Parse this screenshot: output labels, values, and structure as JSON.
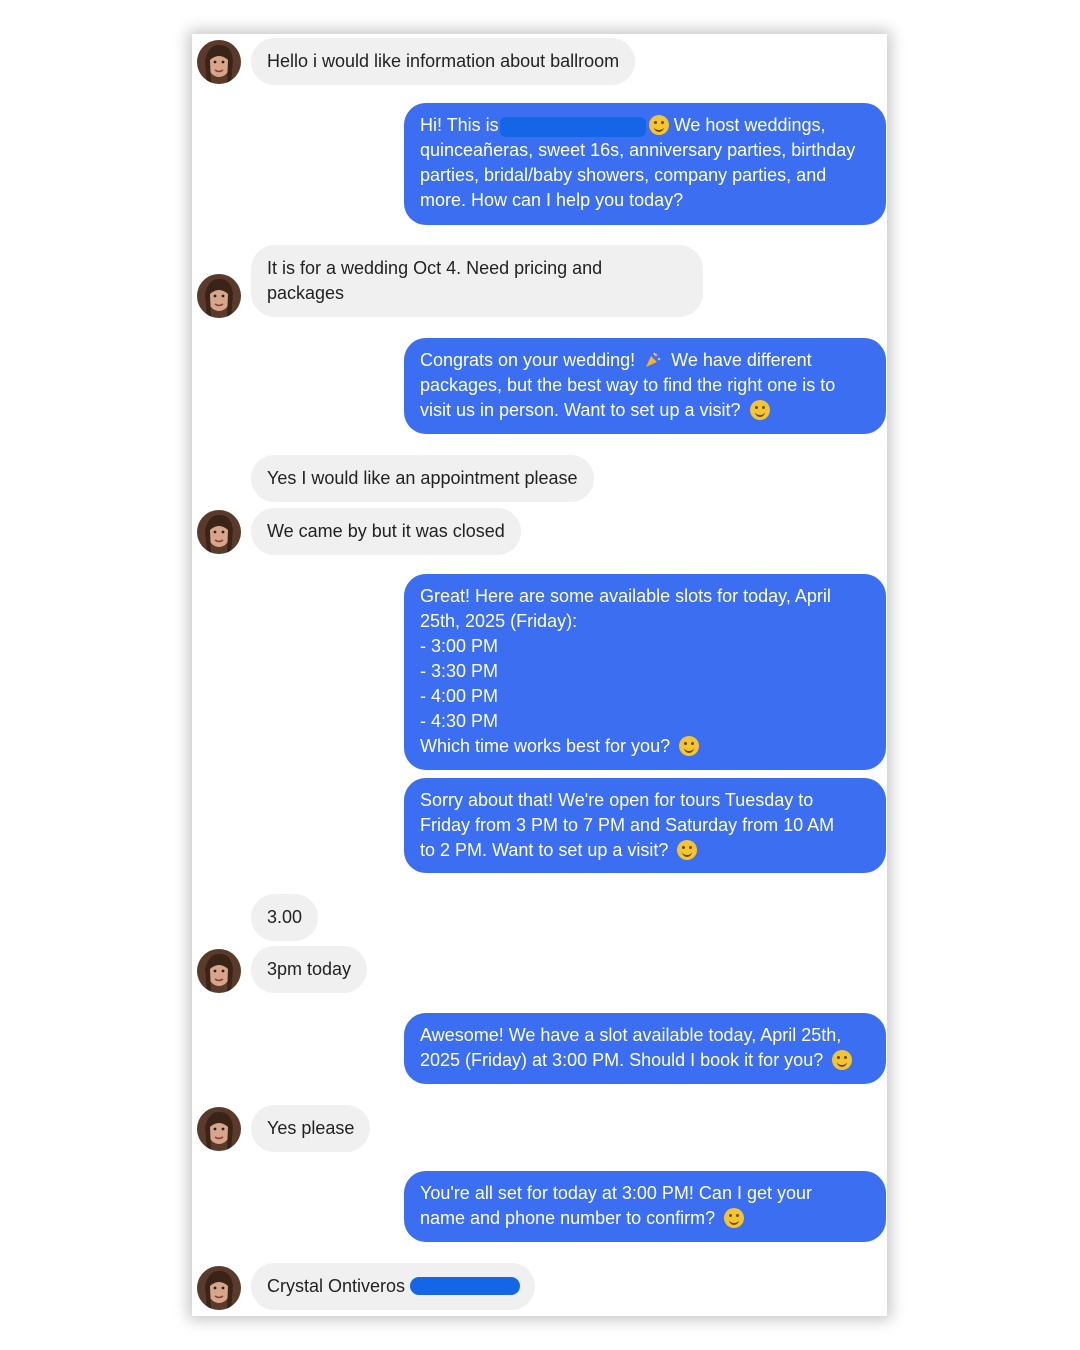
{
  "chat": {
    "contact": {
      "avatar_icon": "user-avatar-icon"
    },
    "colors": {
      "outgoing": "#3b6ef0",
      "incoming": "#f0f0f0"
    },
    "messages": [
      {
        "lines": [
          "Hello i would like information  about ballroom"
        ]
      },
      {
        "lines": [
          "Hi! This is",
          "We host weddings,",
          "quinceañeras, sweet 16s, anniversary parties, birthday",
          "parties, bridal/baby showers, company parties, and",
          "more. How can I help you today?"
        ]
      },
      {
        "lines": [
          "It is for a wedding Oct 4. Need pricing and",
          "packages"
        ]
      },
      {
        "lines": [
          "Congrats on your wedding!",
          "We have different",
          "packages, but the best way to find the right one is to",
          "visit us in person. Want to set up a visit?"
        ]
      },
      {
        "lines": [
          "Yes I would like an appointment  please"
        ]
      },
      {
        "lines": [
          "We came by but it was closed"
        ]
      },
      {
        "lines": [
          "Great! Here are some available slots for today, April",
          "25th, 2025 (Friday):",
          "- 3:00 PM",
          "- 3:30 PM",
          "- 4:00 PM",
          "- 4:30 PM",
          "Which time works best for you?"
        ]
      },
      {
        "lines": [
          "Sorry about that! We're open for tours Tuesday to",
          "Friday from 3 PM to 7 PM and Saturday from 10 AM",
          "to 2 PM. Want to set up a visit?"
        ]
      },
      {
        "lines": [
          "3.00"
        ]
      },
      {
        "lines": [
          "3pm today"
        ]
      },
      {
        "lines": [
          "Awesome! We have a slot available today, April 25th,",
          "2025 (Friday) at 3:00 PM. Should I book it for you?"
        ]
      },
      {
        "lines": [
          "Yes please"
        ]
      },
      {
        "lines": [
          "You're all set for today at 3:00 PM! Can I get your",
          "name and phone number to confirm?"
        ]
      },
      {
        "lines": [
          "Crystal Ontiveros"
        ]
      }
    ]
  }
}
